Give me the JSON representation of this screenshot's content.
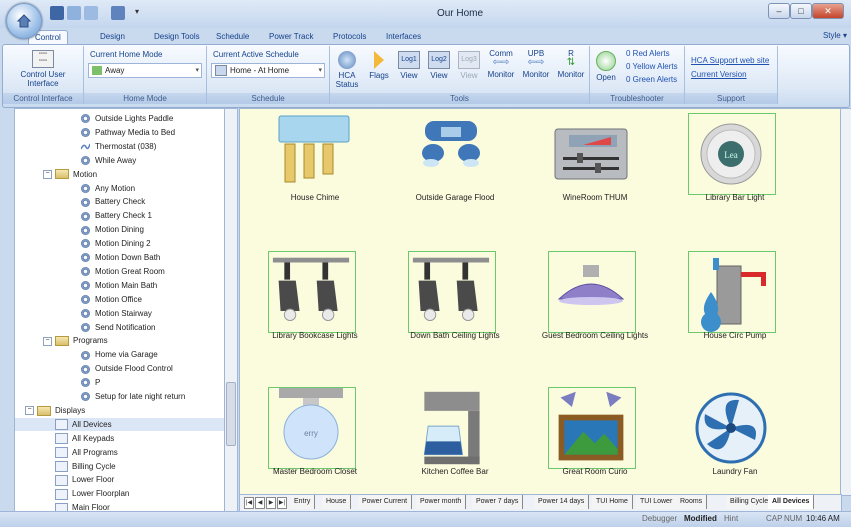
{
  "window": {
    "title": "Our Home",
    "minimize": "–",
    "maximize": "□",
    "close": "✕"
  },
  "tabs": [
    {
      "label": "Control",
      "active": true
    },
    {
      "label": "Design"
    },
    {
      "label": "Design Tools"
    },
    {
      "label": "Schedule"
    },
    {
      "label": "Power Track"
    },
    {
      "label": "Protocols"
    },
    {
      "label": "Interfaces"
    }
  ],
  "style_menu": "Style ▾",
  "ribbon": {
    "control_interface": {
      "button": "Control User Interface",
      "group": "Control Interface"
    },
    "home_mode": {
      "label": "Current Home Mode",
      "value": "Away",
      "group": "Home Mode"
    },
    "schedule": {
      "label": "Current Active Schedule",
      "value": "Home - At Home",
      "group": "Schedule"
    },
    "tools": {
      "group": "Tools",
      "hca_status": "HCA Status",
      "flags": "Flags",
      "log1": "Log1",
      "log2": "Log2",
      "log3": "Log3",
      "view": "View",
      "comm": "Comm",
      "upb": "UPB",
      "r": "R",
      "monitor": "Monitor"
    },
    "troubleshooter": {
      "open": "Open",
      "red": "0 Red Alerts",
      "yellow": "0 Yellow Alerts",
      "green": "0 Green Alerts",
      "group": "Troubleshooter"
    },
    "support": {
      "site": "HCA Support web site",
      "version": "Current Version",
      "group": "Support"
    }
  },
  "tree": [
    {
      "label": "Outside Lights Paddle",
      "indent": 2,
      "icon": "gear"
    },
    {
      "label": "Pathway Media to Bed",
      "indent": 2,
      "icon": "gear"
    },
    {
      "label": "Thermostat (038)",
      "indent": 2,
      "icon": "wave"
    },
    {
      "label": "While Away",
      "indent": 2,
      "icon": "gear"
    },
    {
      "label": "Motion",
      "indent": 1,
      "icon": "folder",
      "expander": "⊟"
    },
    {
      "label": "Any Motion",
      "indent": 2,
      "icon": "gear"
    },
    {
      "label": "Battery Check",
      "indent": 2,
      "icon": "gear"
    },
    {
      "label": "Battery Check 1",
      "indent": 2,
      "icon": "gear"
    },
    {
      "label": "Motion Dining",
      "indent": 2,
      "icon": "gear"
    },
    {
      "label": "Motion Dining 2",
      "indent": 2,
      "icon": "gear"
    },
    {
      "label": "Motion Down Bath",
      "indent": 2,
      "icon": "gear"
    },
    {
      "label": "Motion Great Room",
      "indent": 2,
      "icon": "gear"
    },
    {
      "label": "Motion Main Bath",
      "indent": 2,
      "icon": "gear"
    },
    {
      "label": "Motion Office",
      "indent": 2,
      "icon": "gear"
    },
    {
      "label": "Motion Stairway",
      "indent": 2,
      "icon": "gear"
    },
    {
      "label": "Send Notification",
      "indent": 2,
      "icon": "gear"
    },
    {
      "label": "Programs",
      "indent": 1,
      "icon": "folder",
      "expander": "⊟"
    },
    {
      "label": "Home via Garage",
      "indent": 2,
      "icon": "gear"
    },
    {
      "label": "Outside Flood Control",
      "indent": 2,
      "icon": "gear"
    },
    {
      "label": "P",
      "indent": 2,
      "icon": "gear"
    },
    {
      "label": "Setup for late night return",
      "indent": 2,
      "icon": "gear"
    },
    {
      "label": "Displays",
      "indent": 0,
      "icon": "folder",
      "expander": "⊟"
    },
    {
      "label": "All Devices",
      "indent": 1,
      "icon": "doc",
      "selected": true
    },
    {
      "label": "All Keypads",
      "indent": 1,
      "icon": "doc"
    },
    {
      "label": "All Programs",
      "indent": 1,
      "icon": "doc"
    },
    {
      "label": "Billing Cycle",
      "indent": 1,
      "icon": "doc"
    },
    {
      "label": "Lower Floor",
      "indent": 1,
      "icon": "doc"
    },
    {
      "label": "Lower Floorplan",
      "indent": 1,
      "icon": "doc"
    },
    {
      "label": "Main Floor",
      "indent": 1,
      "icon": "doc"
    }
  ],
  "devices": [
    {
      "label": "House Chime",
      "icon": "chime"
    },
    {
      "label": "Outside Garage Flood",
      "icon": "flood"
    },
    {
      "label": "WineRoom THUM",
      "icon": "thum"
    },
    {
      "label": "Library Bar Light",
      "icon": "barlight",
      "framed": true
    },
    {
      "label": "Library Bookcase Lights",
      "icon": "track",
      "framed": true
    },
    {
      "label": "Down Bath Ceiling Lights",
      "icon": "track",
      "framed": true
    },
    {
      "label": "Guest Bedroom Ceiling Lights",
      "icon": "ceiling",
      "framed": true
    },
    {
      "label": "House Circ Pump",
      "icon": "pump",
      "framed": true
    },
    {
      "label": "Master Bedroom Closet",
      "icon": "bulb",
      "framed": true
    },
    {
      "label": "Kitchen Coffee Bar",
      "icon": "coffee"
    },
    {
      "label": "Great Room Curio",
      "icon": "curio",
      "framed": true
    },
    {
      "label": "Laundry Fan",
      "icon": "fan"
    }
  ],
  "sheet_tabs": [
    "Entry",
    "House",
    "Power Current",
    "Power month",
    "Power 7 days",
    "Power 14 days",
    "TUI Home",
    "TUI Lower",
    "Rooms",
    "Billing Cycle",
    "All Devices"
  ],
  "sheet_nav": [
    "|◀",
    "◀",
    "▶",
    "▶|"
  ],
  "status": {
    "debugger": "Debugger",
    "modified": "Modified",
    "hint": "Hint",
    "caps": "CAP",
    "num": "NUM",
    "time": "10:46 AM"
  }
}
